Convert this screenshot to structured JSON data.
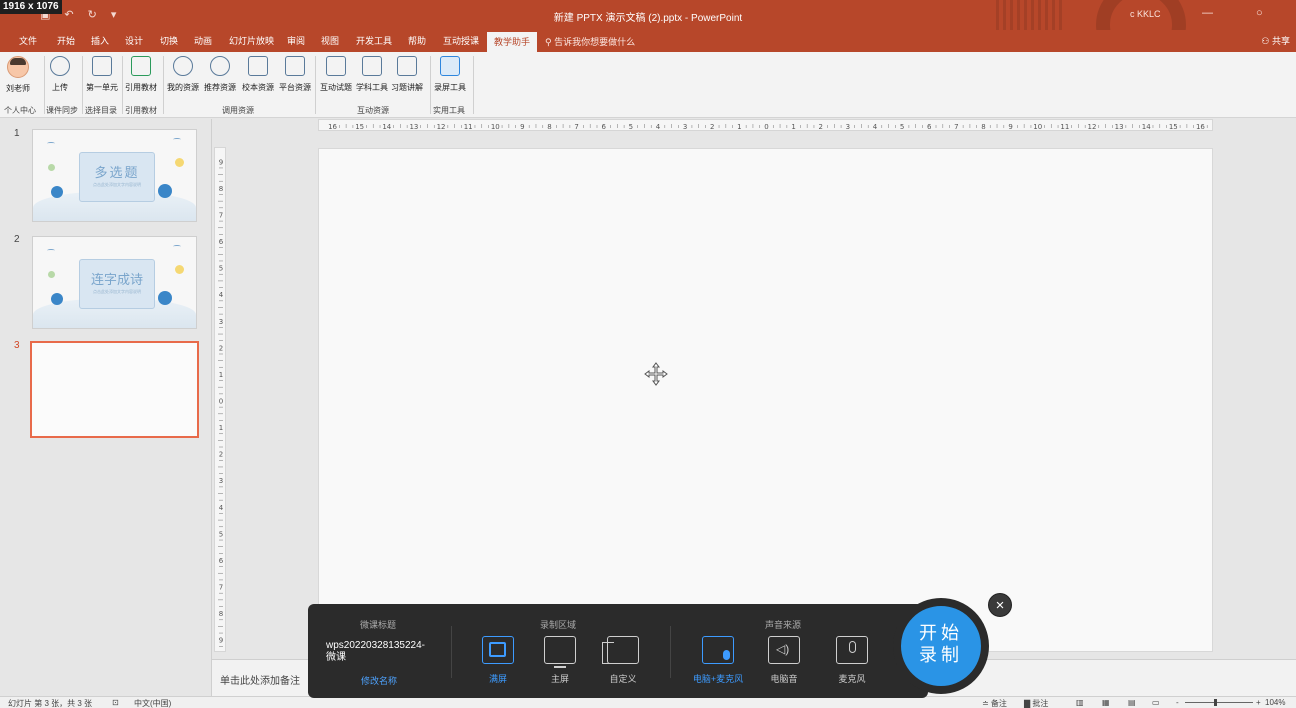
{
  "window": {
    "dim_badge": "1916 x 1076",
    "title": "新建 PPTX 演示文稿 (2).pptx  -  PowerPoint",
    "user": "c KKLC",
    "min_icon": "—",
    "close_icon": "○"
  },
  "qat": {
    "save": "▣",
    "undo": "↶",
    "redo": "↻",
    "more": "▾"
  },
  "tabs": [
    "文件",
    "开始",
    "插入",
    "设计",
    "切换",
    "动画",
    "幻灯片放映",
    "审阅",
    "视图",
    "开发工具",
    "帮助",
    "互动授课",
    "教学助手"
  ],
  "tell_me": "告诉我你想要做什么",
  "share": "共享",
  "ribbon": {
    "buttons": [
      "刘老师",
      "上传",
      "第一单元",
      "引用教材",
      "我的资源",
      "推荐资源",
      "校本资源",
      "平台资源",
      "互动试题",
      "学科工具",
      "习题讲解",
      "录屏工具"
    ],
    "groups": [
      "个人中心",
      "课件同步",
      "选择目录",
      "引用教材",
      "调用资源",
      "互动资源",
      "实用工具"
    ]
  },
  "slides": [
    {
      "num": "1",
      "title": "多选题",
      "subtitle": "点击此处添加文字内容说明"
    },
    {
      "num": "2",
      "title": "连字成诗",
      "subtitle": "点击此处添加文字内容说明"
    },
    {
      "num": "3",
      "title": "",
      "subtitle": ""
    }
  ],
  "ruler": {
    "h_labels": [
      "16",
      "15",
      "14",
      "13",
      "12",
      "11",
      "10",
      "9",
      "8",
      "7",
      "6",
      "5",
      "4",
      "3",
      "2",
      "1",
      "0",
      "1",
      "2",
      "3",
      "4",
      "5",
      "6",
      "7",
      "8",
      "9",
      "10",
      "11",
      "12",
      "13",
      "14",
      "15",
      "16"
    ],
    "v_labels": [
      "9",
      "8",
      "7",
      "6",
      "5",
      "4",
      "3",
      "2",
      "1",
      "0",
      "1",
      "2",
      "3",
      "4",
      "5",
      "6",
      "7",
      "8",
      "9"
    ]
  },
  "notes_placeholder": "单击此处添加备注",
  "status": {
    "slide_info": "幻灯片 第 3 张，共 3 张",
    "language": "中文(中国)",
    "notes": "≐ 备注",
    "comments": "▇ 批注",
    "zoom_minus": "-",
    "zoom_plus": "+",
    "zoom": "104%"
  },
  "recorder": {
    "title_header": "微课标题",
    "area_header": "录制区域",
    "audio_header": "声音来源",
    "file_name": "wps20220328135224-\n微课",
    "rename": "修改名称",
    "areas": [
      "满屏",
      "主屏",
      "自定义"
    ],
    "audio": [
      "电脑+麦克风",
      "电脑音",
      "麦克风"
    ],
    "start_line1": "开始",
    "start_line2": "录制",
    "close": "×"
  },
  "colors": {
    "accent": "#b7472a",
    "record_blue": "#2a94e6",
    "selected_slide": "#e86a4a"
  }
}
